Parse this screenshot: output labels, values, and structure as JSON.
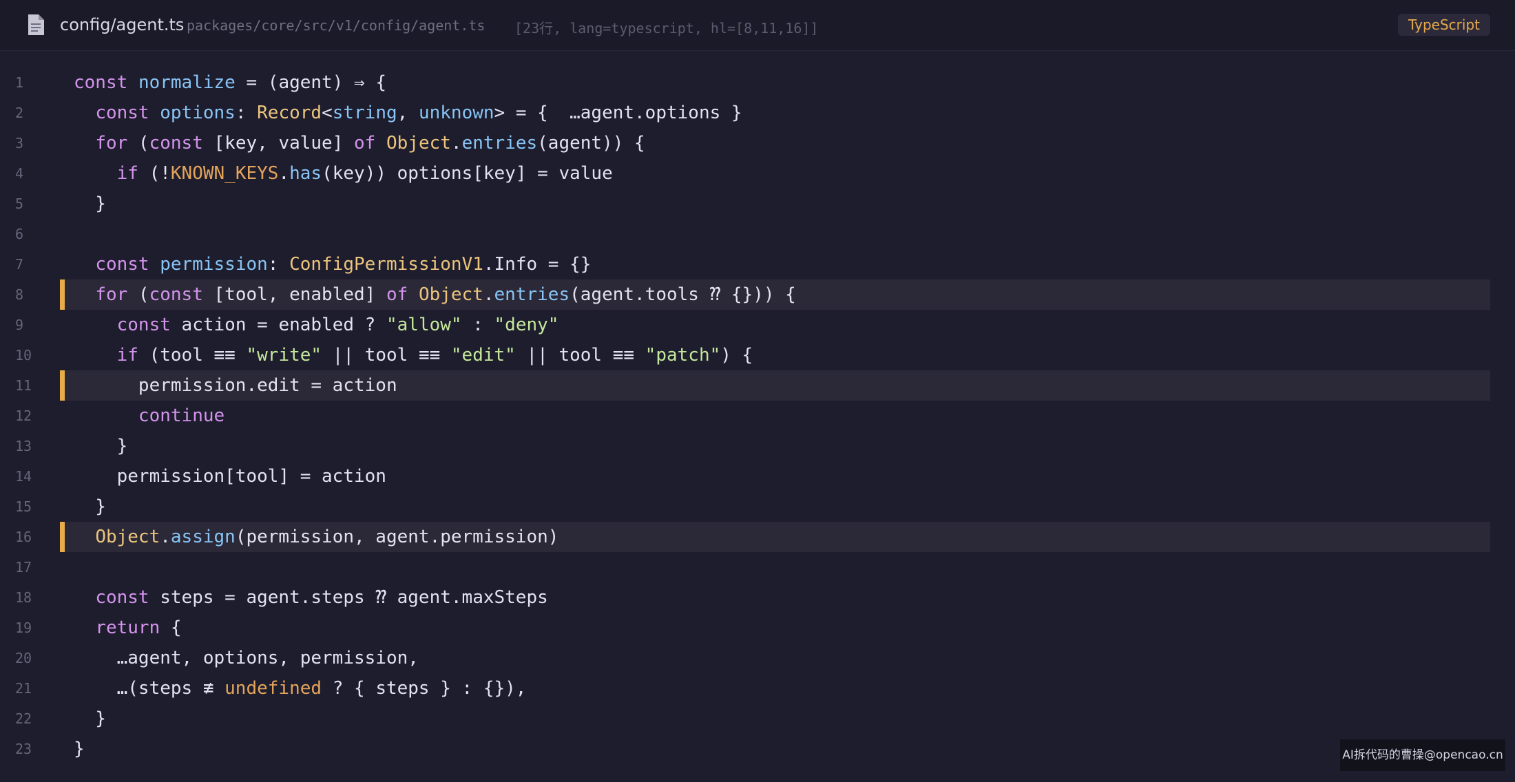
{
  "header": {
    "file_icon": "file-icon",
    "file_name": "config/agent.ts",
    "file_path": "packages/core/src/v1/config/agent.ts",
    "file_meta": "[23行, lang=typescript, hl=[8,11,16]]",
    "language_badge": "TypeScript"
  },
  "colors": {
    "background": "#1e1d2d",
    "highlight_bar": "#e8ad48",
    "keyword": "#d394ec",
    "function": "#89c4f5",
    "type": "#ecc47e",
    "string": "#c4e79b",
    "badge_text": "#e6a94d"
  },
  "code": {
    "highlighted_lines": [
      8,
      11,
      16
    ],
    "lines": [
      {
        "n": "1",
        "tokens": [
          {
            "t": "const",
            "k": "kw"
          },
          {
            "t": " "
          },
          {
            "t": "normalize",
            "k": "fn"
          },
          {
            "t": " = (agent) ⇒ {"
          }
        ]
      },
      {
        "n": "2",
        "tokens": [
          {
            "t": "  "
          },
          {
            "t": "const",
            "k": "kw"
          },
          {
            "t": " "
          },
          {
            "t": "options",
            "k": "fn"
          },
          {
            "t": ": "
          },
          {
            "t": "Record",
            "k": "ty"
          },
          {
            "t": "<"
          },
          {
            "t": "string",
            "k": "fn"
          },
          {
            "t": ", "
          },
          {
            "t": "unknown",
            "k": "fn"
          },
          {
            "t": "> = {  …agent.options }"
          }
        ]
      },
      {
        "n": "3",
        "tokens": [
          {
            "t": "  "
          },
          {
            "t": "for",
            "k": "kw"
          },
          {
            "t": " ("
          },
          {
            "t": "const",
            "k": "kw"
          },
          {
            "t": " [key, value] "
          },
          {
            "t": "of",
            "k": "kw"
          },
          {
            "t": " "
          },
          {
            "t": "Object",
            "k": "ty"
          },
          {
            "t": "."
          },
          {
            "t": "entries",
            "k": "fn"
          },
          {
            "t": "(agent)) {"
          }
        ]
      },
      {
        "n": "4",
        "tokens": [
          {
            "t": "    "
          },
          {
            "t": "if",
            "k": "kw"
          },
          {
            "t": " (!"
          },
          {
            "t": "KNOWN_KEYS",
            "k": "const"
          },
          {
            "t": "."
          },
          {
            "t": "has",
            "k": "fn"
          },
          {
            "t": "(key)) options[key] = value"
          }
        ]
      },
      {
        "n": "5",
        "tokens": [
          {
            "t": "  }"
          }
        ]
      },
      {
        "n": "6",
        "tokens": []
      },
      {
        "n": "7",
        "tokens": [
          {
            "t": "  "
          },
          {
            "t": "const",
            "k": "kw"
          },
          {
            "t": " "
          },
          {
            "t": "permission",
            "k": "fn"
          },
          {
            "t": ": "
          },
          {
            "t": "ConfigPermissionV1",
            "k": "ty"
          },
          {
            "t": ".Info = {}"
          }
        ]
      },
      {
        "n": "8",
        "tokens": [
          {
            "t": "  "
          },
          {
            "t": "for",
            "k": "kw"
          },
          {
            "t": " ("
          },
          {
            "t": "const",
            "k": "kw"
          },
          {
            "t": " [tool, enabled] "
          },
          {
            "t": "of",
            "k": "kw"
          },
          {
            "t": " "
          },
          {
            "t": "Object",
            "k": "ty"
          },
          {
            "t": "."
          },
          {
            "t": "entries",
            "k": "fn"
          },
          {
            "t": "(agent.tools ⁇ {})) {"
          }
        ]
      },
      {
        "n": "9",
        "tokens": [
          {
            "t": "    "
          },
          {
            "t": "const",
            "k": "kw"
          },
          {
            "t": " action = enabled ? "
          },
          {
            "t": "\"allow\"",
            "k": "str"
          },
          {
            "t": " : "
          },
          {
            "t": "\"deny\"",
            "k": "str"
          }
        ]
      },
      {
        "n": "10",
        "tokens": [
          {
            "t": "    "
          },
          {
            "t": "if",
            "k": "kw"
          },
          {
            "t": " (tool ≡≡ "
          },
          {
            "t": "\"write\"",
            "k": "str"
          },
          {
            "t": " || tool ≡≡ "
          },
          {
            "t": "\"edit\"",
            "k": "str"
          },
          {
            "t": " || tool ≡≡ "
          },
          {
            "t": "\"patch\"",
            "k": "str"
          },
          {
            "t": ") {"
          }
        ]
      },
      {
        "n": "11",
        "tokens": [
          {
            "t": "      permission.edit = action"
          }
        ]
      },
      {
        "n": "12",
        "tokens": [
          {
            "t": "      "
          },
          {
            "t": "continue",
            "k": "kw"
          }
        ]
      },
      {
        "n": "13",
        "tokens": [
          {
            "t": "    }"
          }
        ]
      },
      {
        "n": "14",
        "tokens": [
          {
            "t": "    permission[tool] = action"
          }
        ]
      },
      {
        "n": "15",
        "tokens": [
          {
            "t": "  }"
          }
        ]
      },
      {
        "n": "16",
        "tokens": [
          {
            "t": "  "
          },
          {
            "t": "Object",
            "k": "ty"
          },
          {
            "t": "."
          },
          {
            "t": "assign",
            "k": "fn"
          },
          {
            "t": "(permission, agent.permission)"
          }
        ]
      },
      {
        "n": "17",
        "tokens": []
      },
      {
        "n": "18",
        "tokens": [
          {
            "t": "  "
          },
          {
            "t": "const",
            "k": "kw"
          },
          {
            "t": " steps = agent.steps ⁇ agent.maxSteps"
          }
        ]
      },
      {
        "n": "19",
        "tokens": [
          {
            "t": "  "
          },
          {
            "t": "return",
            "k": "kw"
          },
          {
            "t": " {"
          }
        ]
      },
      {
        "n": "20",
        "tokens": [
          {
            "t": "    …agent, options, permission,"
          }
        ]
      },
      {
        "n": "21",
        "tokens": [
          {
            "t": "    …(steps ≢ "
          },
          {
            "t": "undefined",
            "k": "const"
          },
          {
            "t": " ? { steps } : {}),"
          }
        ]
      },
      {
        "n": "22",
        "tokens": [
          {
            "t": "  }"
          }
        ]
      },
      {
        "n": "23",
        "tokens": [
          {
            "t": "}"
          }
        ]
      }
    ]
  },
  "watermark": "AI拆代码的曹操@opencao.cn"
}
